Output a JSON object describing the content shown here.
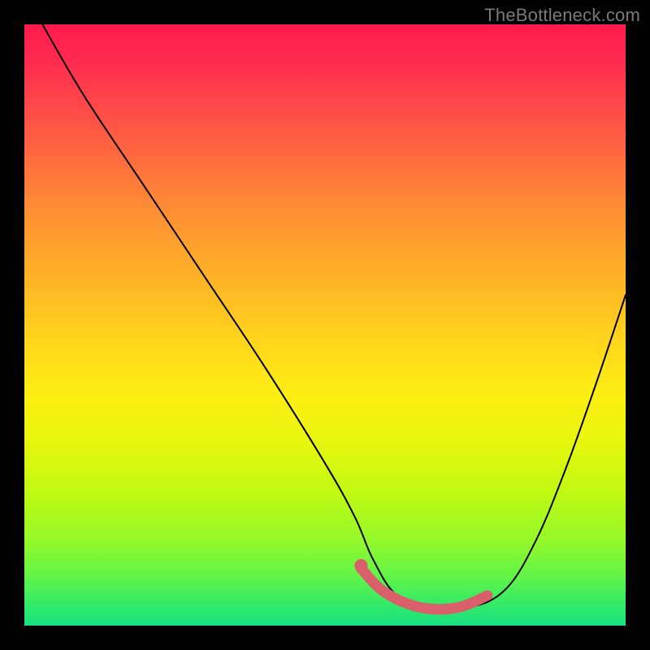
{
  "watermark": "TheBottleneck.com",
  "chart_data": {
    "type": "line",
    "title": "",
    "xlabel": "",
    "ylabel": "",
    "xlim": [
      0,
      100
    ],
    "ylim": [
      0,
      100
    ],
    "grid": false,
    "series": [
      {
        "name": "bottleneck-curve",
        "x": [
          3,
          10,
          20,
          30,
          40,
          50,
          55,
          58,
          62,
          68,
          74,
          80,
          85,
          90,
          95,
          100
        ],
        "y": [
          100,
          88,
          73,
          58,
          43,
          27,
          18,
          11,
          5,
          3,
          3,
          6,
          14,
          26,
          40,
          55
        ]
      }
    ],
    "highlight": {
      "name": "optimal-range",
      "x": [
        56,
        60,
        66,
        72,
        77
      ],
      "y": [
        9.5,
        5.5,
        3,
        3,
        5
      ]
    },
    "marker": {
      "name": "optimal-point",
      "x": 56,
      "y": 10
    },
    "gradient_stops": [
      {
        "pos": 0,
        "color": "#ff1a4d"
      },
      {
        "pos": 50,
        "color": "#ffd400"
      },
      {
        "pos": 100,
        "color": "#18e180"
      }
    ]
  }
}
